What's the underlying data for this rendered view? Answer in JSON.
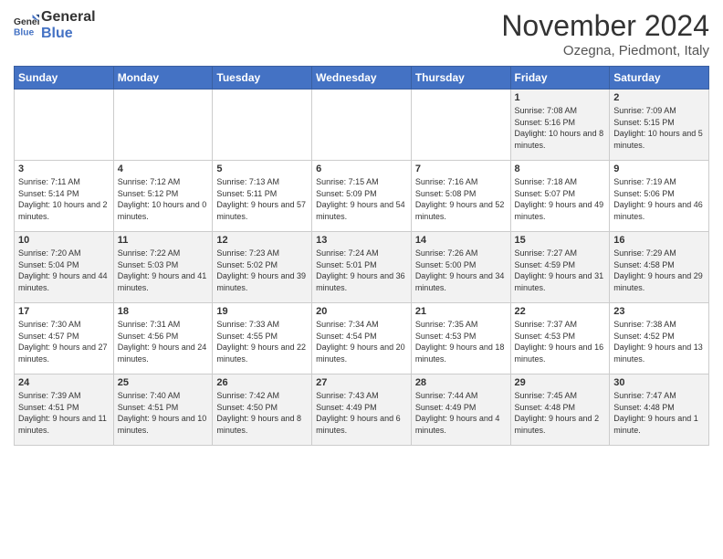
{
  "header": {
    "logo_general": "General",
    "logo_blue": "Blue",
    "month_title": "November 2024",
    "subtitle": "Ozegna, Piedmont, Italy"
  },
  "days_of_week": [
    "Sunday",
    "Monday",
    "Tuesday",
    "Wednesday",
    "Thursday",
    "Friday",
    "Saturday"
  ],
  "weeks": [
    [
      {
        "day": "",
        "info": ""
      },
      {
        "day": "",
        "info": ""
      },
      {
        "day": "",
        "info": ""
      },
      {
        "day": "",
        "info": ""
      },
      {
        "day": "",
        "info": ""
      },
      {
        "day": "1",
        "info": "Sunrise: 7:08 AM\nSunset: 5:16 PM\nDaylight: 10 hours and 8 minutes."
      },
      {
        "day": "2",
        "info": "Sunrise: 7:09 AM\nSunset: 5:15 PM\nDaylight: 10 hours and 5 minutes."
      }
    ],
    [
      {
        "day": "3",
        "info": "Sunrise: 7:11 AM\nSunset: 5:14 PM\nDaylight: 10 hours and 2 minutes."
      },
      {
        "day": "4",
        "info": "Sunrise: 7:12 AM\nSunset: 5:12 PM\nDaylight: 10 hours and 0 minutes."
      },
      {
        "day": "5",
        "info": "Sunrise: 7:13 AM\nSunset: 5:11 PM\nDaylight: 9 hours and 57 minutes."
      },
      {
        "day": "6",
        "info": "Sunrise: 7:15 AM\nSunset: 5:09 PM\nDaylight: 9 hours and 54 minutes."
      },
      {
        "day": "7",
        "info": "Sunrise: 7:16 AM\nSunset: 5:08 PM\nDaylight: 9 hours and 52 minutes."
      },
      {
        "day": "8",
        "info": "Sunrise: 7:18 AM\nSunset: 5:07 PM\nDaylight: 9 hours and 49 minutes."
      },
      {
        "day": "9",
        "info": "Sunrise: 7:19 AM\nSunset: 5:06 PM\nDaylight: 9 hours and 46 minutes."
      }
    ],
    [
      {
        "day": "10",
        "info": "Sunrise: 7:20 AM\nSunset: 5:04 PM\nDaylight: 9 hours and 44 minutes."
      },
      {
        "day": "11",
        "info": "Sunrise: 7:22 AM\nSunset: 5:03 PM\nDaylight: 9 hours and 41 minutes."
      },
      {
        "day": "12",
        "info": "Sunrise: 7:23 AM\nSunset: 5:02 PM\nDaylight: 9 hours and 39 minutes."
      },
      {
        "day": "13",
        "info": "Sunrise: 7:24 AM\nSunset: 5:01 PM\nDaylight: 9 hours and 36 minutes."
      },
      {
        "day": "14",
        "info": "Sunrise: 7:26 AM\nSunset: 5:00 PM\nDaylight: 9 hours and 34 minutes."
      },
      {
        "day": "15",
        "info": "Sunrise: 7:27 AM\nSunset: 4:59 PM\nDaylight: 9 hours and 31 minutes."
      },
      {
        "day": "16",
        "info": "Sunrise: 7:29 AM\nSunset: 4:58 PM\nDaylight: 9 hours and 29 minutes."
      }
    ],
    [
      {
        "day": "17",
        "info": "Sunrise: 7:30 AM\nSunset: 4:57 PM\nDaylight: 9 hours and 27 minutes."
      },
      {
        "day": "18",
        "info": "Sunrise: 7:31 AM\nSunset: 4:56 PM\nDaylight: 9 hours and 24 minutes."
      },
      {
        "day": "19",
        "info": "Sunrise: 7:33 AM\nSunset: 4:55 PM\nDaylight: 9 hours and 22 minutes."
      },
      {
        "day": "20",
        "info": "Sunrise: 7:34 AM\nSunset: 4:54 PM\nDaylight: 9 hours and 20 minutes."
      },
      {
        "day": "21",
        "info": "Sunrise: 7:35 AM\nSunset: 4:53 PM\nDaylight: 9 hours and 18 minutes."
      },
      {
        "day": "22",
        "info": "Sunrise: 7:37 AM\nSunset: 4:53 PM\nDaylight: 9 hours and 16 minutes."
      },
      {
        "day": "23",
        "info": "Sunrise: 7:38 AM\nSunset: 4:52 PM\nDaylight: 9 hours and 13 minutes."
      }
    ],
    [
      {
        "day": "24",
        "info": "Sunrise: 7:39 AM\nSunset: 4:51 PM\nDaylight: 9 hours and 11 minutes."
      },
      {
        "day": "25",
        "info": "Sunrise: 7:40 AM\nSunset: 4:51 PM\nDaylight: 9 hours and 10 minutes."
      },
      {
        "day": "26",
        "info": "Sunrise: 7:42 AM\nSunset: 4:50 PM\nDaylight: 9 hours and 8 minutes."
      },
      {
        "day": "27",
        "info": "Sunrise: 7:43 AM\nSunset: 4:49 PM\nDaylight: 9 hours and 6 minutes."
      },
      {
        "day": "28",
        "info": "Sunrise: 7:44 AM\nSunset: 4:49 PM\nDaylight: 9 hours and 4 minutes."
      },
      {
        "day": "29",
        "info": "Sunrise: 7:45 AM\nSunset: 4:48 PM\nDaylight: 9 hours and 2 minutes."
      },
      {
        "day": "30",
        "info": "Sunrise: 7:47 AM\nSunset: 4:48 PM\nDaylight: 9 hours and 1 minute."
      }
    ]
  ]
}
